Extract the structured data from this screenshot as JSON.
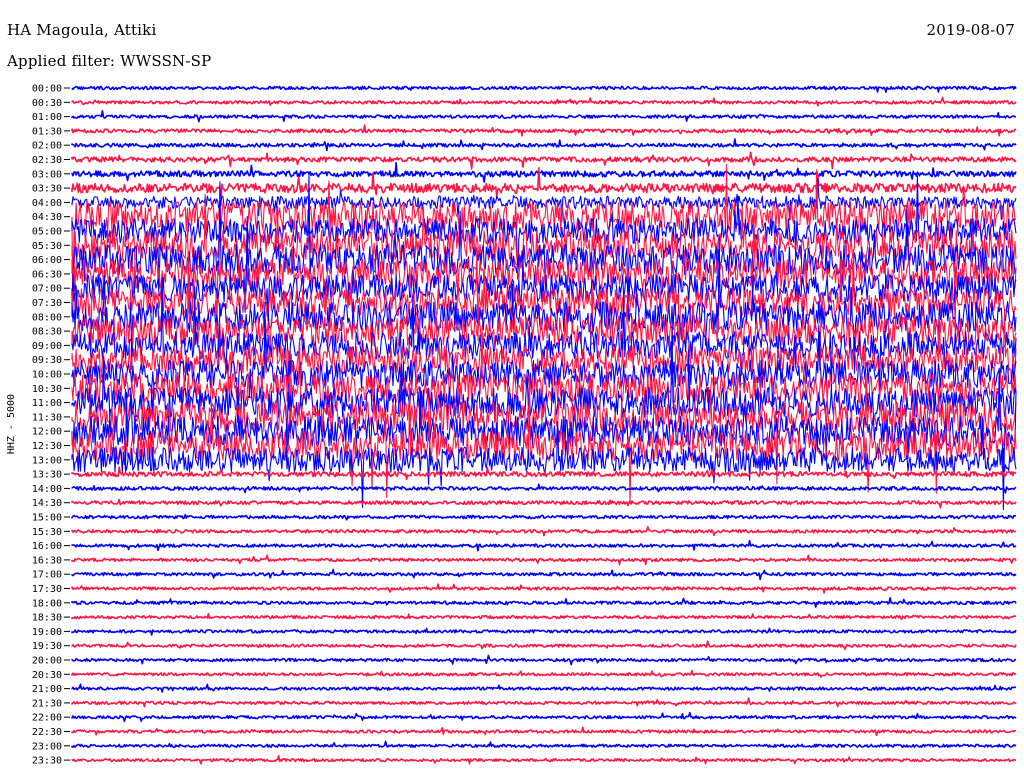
{
  "header": {
    "station": "HA Magoula, Attiki",
    "filter_label": "Applied filter: WWSSN-SP",
    "date": "2019-08-07"
  },
  "colors": {
    "odd": "#0000ff",
    "even": "#ff1744",
    "background": "#ffffff"
  },
  "chart_data": {
    "type": "line",
    "title": "HA Magoula, Attiki",
    "subtitle": "Applied filter: WWSSN-SP",
    "date": "2019-08-07",
    "ylabel": "HHZ - 5000",
    "xlabel": "",
    "traces": [
      {
        "label": "00:00",
        "color": "blue",
        "activity": 0.15
      },
      {
        "label": "00:30",
        "color": "red",
        "activity": 0.15
      },
      {
        "label": "01:00",
        "color": "blue",
        "activity": 0.15
      },
      {
        "label": "01:30",
        "color": "red",
        "activity": 0.2
      },
      {
        "label": "02:00",
        "color": "blue",
        "activity": 0.2
      },
      {
        "label": "02:30",
        "color": "red",
        "activity": 0.3
      },
      {
        "label": "03:00",
        "color": "blue",
        "activity": 0.35
      },
      {
        "label": "03:30",
        "color": "red",
        "activity": 0.5
      },
      {
        "label": "04:00",
        "color": "blue",
        "activity": 0.6
      },
      {
        "label": "04:30",
        "color": "red",
        "activity": 1.0
      },
      {
        "label": "05:00",
        "color": "blue",
        "activity": 0.9
      },
      {
        "label": "05:30",
        "color": "red",
        "activity": 1.0
      },
      {
        "label": "06:00",
        "color": "blue",
        "activity": 1.0
      },
      {
        "label": "06:30",
        "color": "red",
        "activity": 1.0
      },
      {
        "label": "07:00",
        "color": "blue",
        "activity": 0.95
      },
      {
        "label": "07:30",
        "color": "red",
        "activity": 0.95
      },
      {
        "label": "08:00",
        "color": "blue",
        "activity": 1.0
      },
      {
        "label": "08:30",
        "color": "red",
        "activity": 1.0
      },
      {
        "label": "09:00",
        "color": "blue",
        "activity": 0.95
      },
      {
        "label": "09:30",
        "color": "red",
        "activity": 0.95
      },
      {
        "label": "10:00",
        "color": "blue",
        "activity": 0.95
      },
      {
        "label": "10:30",
        "color": "red",
        "activity": 1.0
      },
      {
        "label": "11:00",
        "color": "blue",
        "activity": 1.0
      },
      {
        "label": "11:30",
        "color": "red",
        "activity": 1.0
      },
      {
        "label": "12:00",
        "color": "blue",
        "activity": 1.0
      },
      {
        "label": "12:30",
        "color": "red",
        "activity": 1.0
      },
      {
        "label": "13:00",
        "color": "blue",
        "activity": 0.9
      },
      {
        "label": "13:30",
        "color": "red",
        "activity": 0.3
      },
      {
        "label": "14:00",
        "color": "blue",
        "activity": 0.2
      },
      {
        "label": "14:30",
        "color": "red",
        "activity": 0.2
      },
      {
        "label": "15:00",
        "color": "blue",
        "activity": 0.15
      },
      {
        "label": "15:30",
        "color": "red",
        "activity": 0.15
      },
      {
        "label": "16:00",
        "color": "blue",
        "activity": 0.15
      },
      {
        "label": "16:30",
        "color": "red",
        "activity": 0.15
      },
      {
        "label": "17:00",
        "color": "blue",
        "activity": 0.15
      },
      {
        "label": "17:30",
        "color": "red",
        "activity": 0.12
      },
      {
        "label": "18:00",
        "color": "blue",
        "activity": 0.15
      },
      {
        "label": "18:30",
        "color": "red",
        "activity": 0.12
      },
      {
        "label": "19:00",
        "color": "blue",
        "activity": 0.12
      },
      {
        "label": "19:30",
        "color": "red",
        "activity": 0.12
      },
      {
        "label": "20:00",
        "color": "blue",
        "activity": 0.12
      },
      {
        "label": "20:30",
        "color": "red",
        "activity": 0.12
      },
      {
        "label": "21:00",
        "color": "blue",
        "activity": 0.12
      },
      {
        "label": "21:30",
        "color": "red",
        "activity": 0.12
      },
      {
        "label": "22:00",
        "color": "blue",
        "activity": 0.12
      },
      {
        "label": "22:30",
        "color": "red",
        "activity": 0.12
      },
      {
        "label": "23:00",
        "color": "blue",
        "activity": 0.12
      },
      {
        "label": "23:30",
        "color": "red",
        "activity": 0.12
      }
    ]
  }
}
